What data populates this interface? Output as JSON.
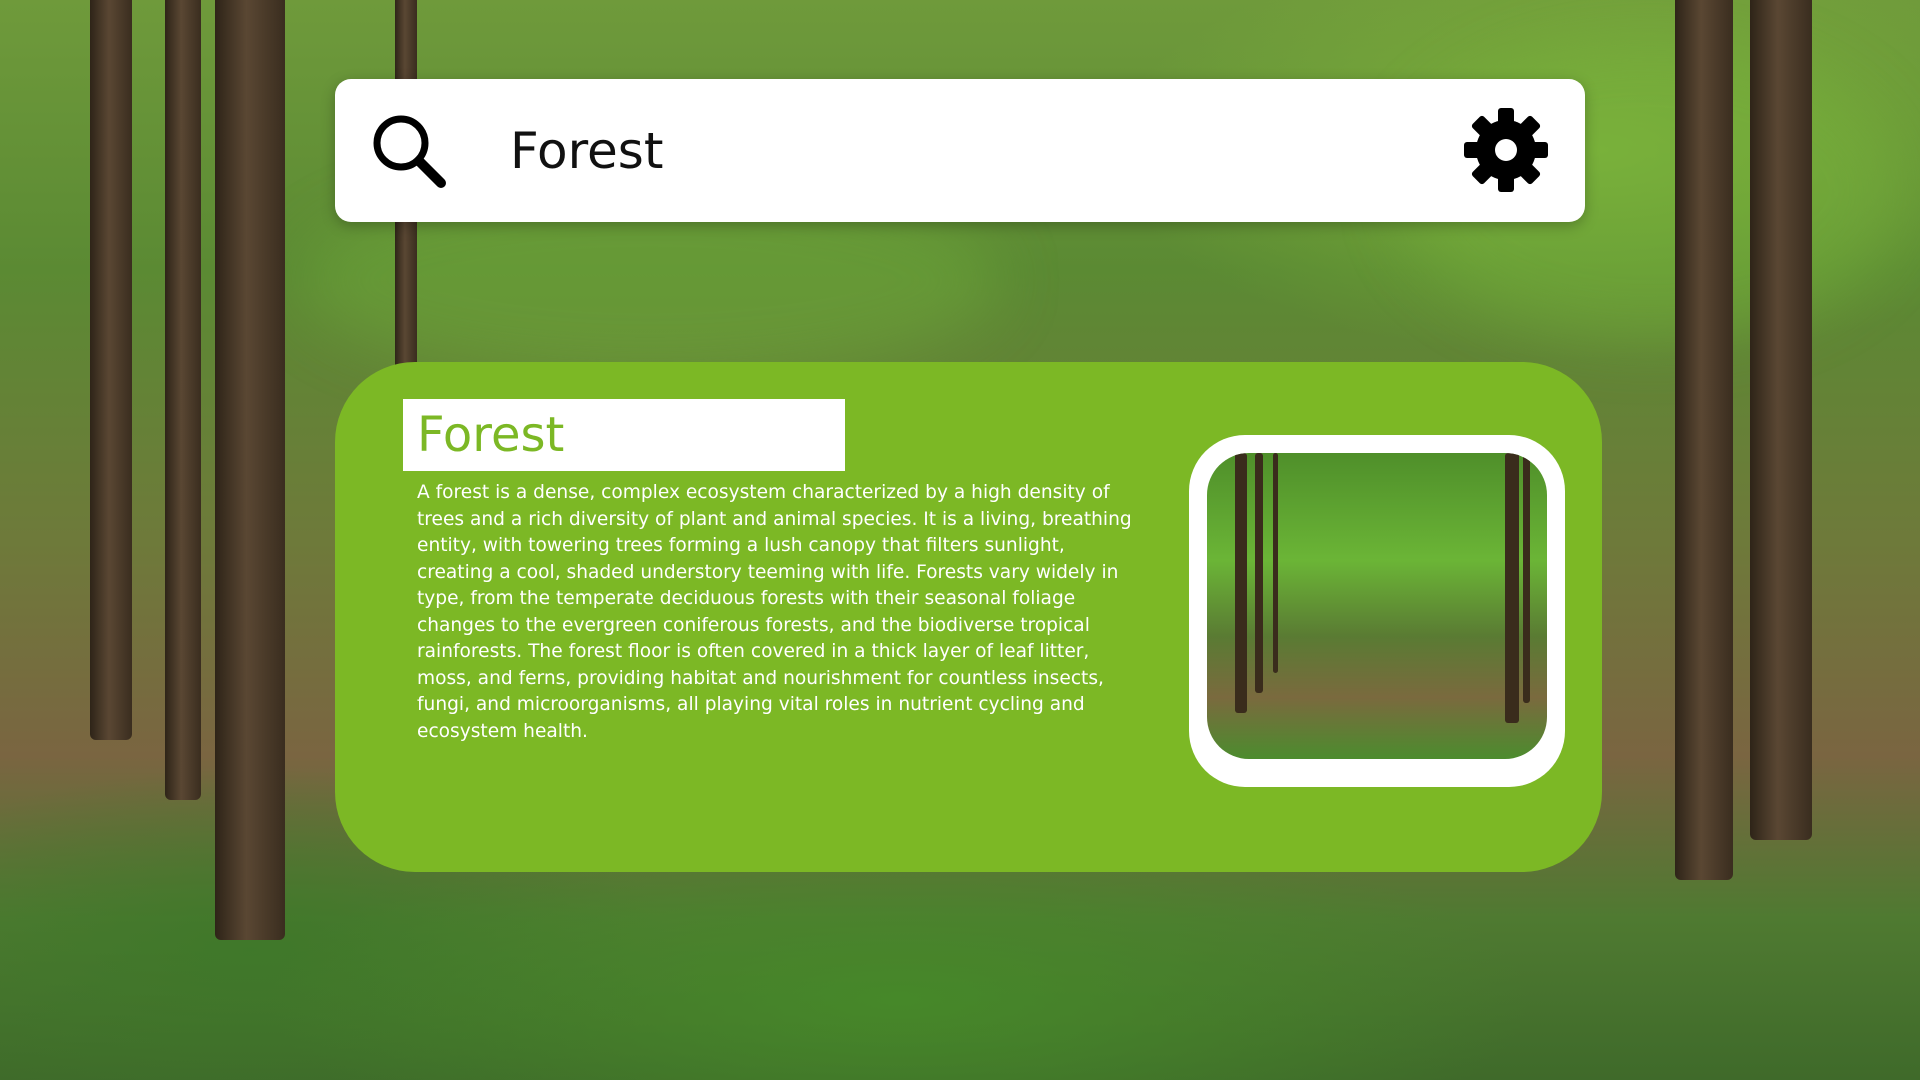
{
  "search": {
    "query": "Forest"
  },
  "icons": {
    "search": "search-icon",
    "settings": "gear-icon"
  },
  "card": {
    "title": "Forest",
    "description": "A forest is a dense, complex ecosystem characterized by a high density of trees and a rich diversity of plant and animal species. It is a living, breathing entity, with towering trees forming a lush canopy that filters sunlight, creating a cool, shaded understory teeming with life. Forests vary widely in type, from the temperate deciduous forests with their seasonal foliage changes to the evergreen coniferous forests, and the biodiverse tropical rainforests. The forest floor is often covered in a thick layer of leaf litter, moss, and ferns, providing habitat and nourishment for countless insects, fungi, and microorganisms, all playing vital roles in nutrient cycling and ecosystem health."
  },
  "colors": {
    "card_background": "#7cb825",
    "title_text": "#7cb825",
    "search_bar_background": "#ffffff"
  }
}
